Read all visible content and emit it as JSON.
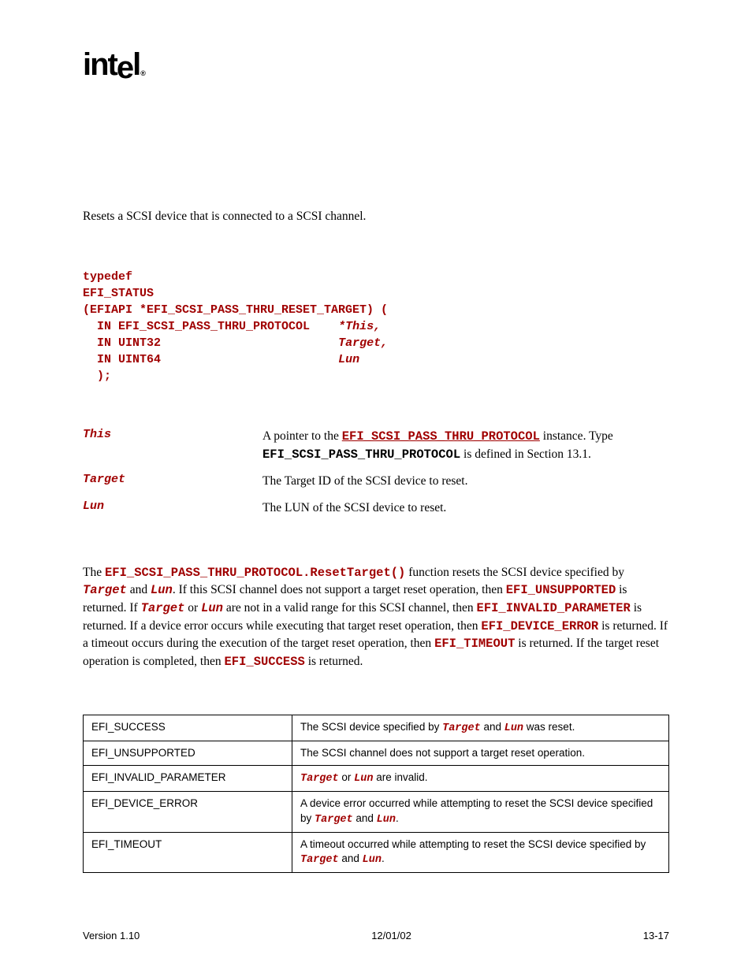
{
  "logo": {
    "text": "int",
    "e": "e",
    "l": "l",
    "sub": "®"
  },
  "summary": "Resets a SCSI device that is connected to a SCSI channel.",
  "prototype": {
    "l1": "typedef",
    "l2": "EFI_STATUS",
    "l3": "(EFIAPI *EFI_SCSI_PASS_THRU_RESET_TARGET) (",
    "l4a": "  IN EFI_SCSI_PASS_THRU_PROTOCOL    ",
    "l4b": "*This,",
    "l5a": "  IN UINT32                         ",
    "l5b": "Target,",
    "l6a": "  IN UINT64                         ",
    "l6b": "Lun",
    "l7": "  );"
  },
  "params": {
    "p1": {
      "name": "This",
      "pre": "A pointer to the ",
      "link": "EFI_SCSI_PASS_THRU_PROTOCOL",
      "mid": " instance.  Type ",
      "code": "EFI_SCSI_PASS_THRU_PROTOCOL",
      "post": " is defined in Section 13.1."
    },
    "p2": {
      "name": "Target",
      "desc": "The Target ID of the SCSI device to reset."
    },
    "p3": {
      "name": "Lun",
      "desc": "The LUN of the SCSI device to reset."
    }
  },
  "desc": {
    "t1": "The ",
    "c1": "EFI_SCSI_PASS_THRU_PROTOCOL.ResetTarget()",
    "t2": " function resets the SCSI device specified by ",
    "i1": "Target",
    "t3": " and ",
    "i2": "Lun",
    "t4": ".  If this SCSI channel does not support a target reset operation, then ",
    "c2": "EFI_UNSUPPORTED",
    "t5": " is returned.  If ",
    "i3": "Target",
    "t6": " or ",
    "i4": "Lun",
    "t7": " are not in a valid range for this SCSI channel, then ",
    "c3": "EFI_INVALID_PARAMETER",
    "t8": " is returned.  If a device error occurs while executing that target reset operation, then ",
    "c4": "EFI_DEVICE_ERROR",
    "t9": " is returned.  If a timeout occurs during the execution of the target reset operation, then ",
    "c5": "EFI_TIMEOUT",
    "t10": " is returned.  If the target reset operation is completed, then ",
    "c6": "EFI_SUCCESS",
    "t11": " is returned."
  },
  "table": {
    "r1": {
      "code": "EFI_SUCCESS",
      "pre": "The SCSI device specified by ",
      "i1": "Target",
      "mid": " and ",
      "i2": "Lun",
      "post": " was reset."
    },
    "r2": {
      "code": "EFI_UNSUPPORTED",
      "desc": "The SCSI channel does not support a target reset operation."
    },
    "r3": {
      "code": "EFI_INVALID_PARAMETER",
      "i1": "Target",
      "mid": " or ",
      "i2": "Lun",
      "post": " are invalid."
    },
    "r4": {
      "code": "EFI_DEVICE_ERROR",
      "pre": "A device error occurred while attempting to reset the SCSI device specified by ",
      "i1": "Target",
      "mid": " and ",
      "i2": "Lun",
      "post": "."
    },
    "r5": {
      "code": "EFI_TIMEOUT",
      "pre": "A timeout occurred while attempting to reset the SCSI device specified by ",
      "i1": "Target",
      "mid": " and ",
      "i2": "Lun",
      "post": "."
    }
  },
  "footer": {
    "left": "Version 1.10",
    "center": "12/01/02",
    "right": "13-17"
  }
}
